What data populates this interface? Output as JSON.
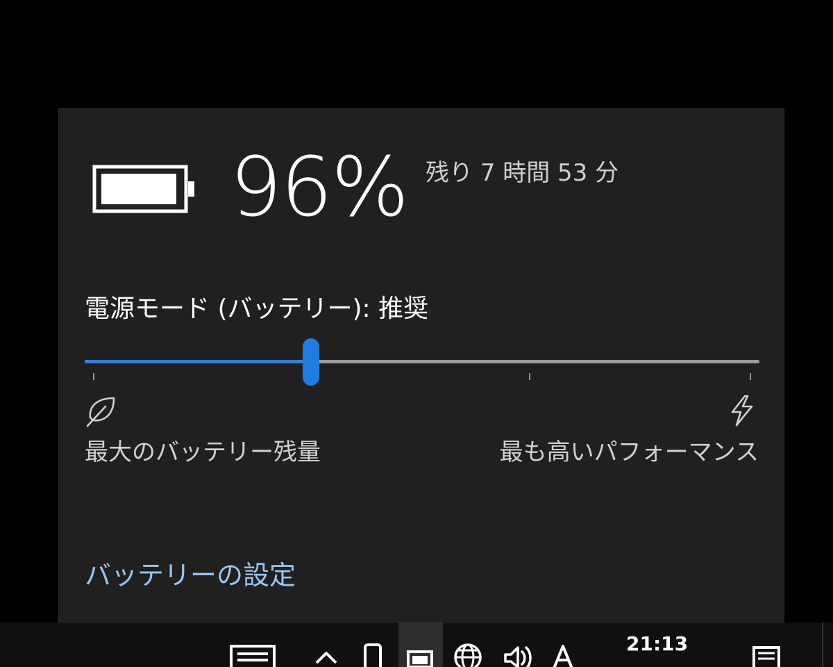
{
  "battery": {
    "percent": "96%",
    "percent_value": 96,
    "time_remaining": "残り 7 時間 53 分"
  },
  "power_mode": {
    "label": "電源モード (バッテリー): 推奨",
    "slider_position": 0.335,
    "min_label": "最大のバッテリー残量",
    "max_label": "最も高いパフォーマンス",
    "min_icon": "leaf-icon",
    "max_icon": "lightning-bolt-icon"
  },
  "links": {
    "battery_settings": "バッテリーの設定"
  },
  "taskbar": {
    "clock": "21:13",
    "icons": [
      "keyboard-icon",
      "chevron-up-icon",
      "phone-icon",
      "battery-icon",
      "globe-icon",
      "speaker-icon",
      "ime-icon",
      "notification-icon"
    ]
  },
  "colors": {
    "accent": "#1f7de0",
    "link": "#9ac4f0",
    "panel_background": "#202020"
  }
}
